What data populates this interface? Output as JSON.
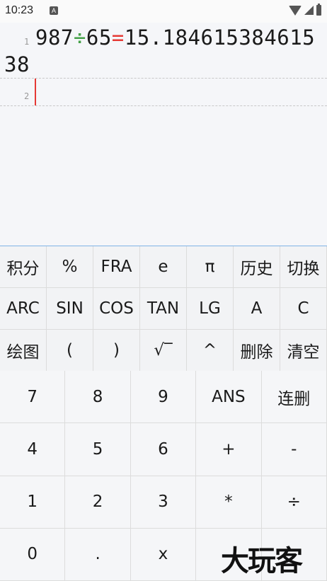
{
  "status_bar": {
    "time": "10:23",
    "notification_glyph": "A"
  },
  "display": {
    "lines": [
      {
        "number": "1",
        "operand_a": "987",
        "operator": "÷",
        "operand_b": "65",
        "equals": "=",
        "result": "15.184615384615 38"
      },
      {
        "number": "2"
      }
    ]
  },
  "function_keys": [
    [
      "积分",
      "%",
      "FRA",
      "e",
      "π",
      "历史",
      "切换"
    ],
    [
      "ARC",
      "SIN",
      "COS",
      "TAN",
      "LG",
      "A",
      "C"
    ],
    [
      "绘图",
      "(",
      ")",
      "√‾",
      "^",
      "删除",
      "清空"
    ]
  ],
  "number_keys": [
    [
      "7",
      "8",
      "9",
      "ANS",
      "连删"
    ],
    [
      "4",
      "5",
      "6",
      "+",
      "-"
    ],
    [
      "1",
      "2",
      "3",
      "*",
      "÷"
    ],
    [
      "0",
      ".",
      "x",
      "",
      ""
    ]
  ],
  "watermark": "大玩客",
  "colors": {
    "divide_operator": "#43a047",
    "equals_sign": "#e53935",
    "cursor": "#e53935",
    "keypad_border": "#7fb3e6"
  }
}
